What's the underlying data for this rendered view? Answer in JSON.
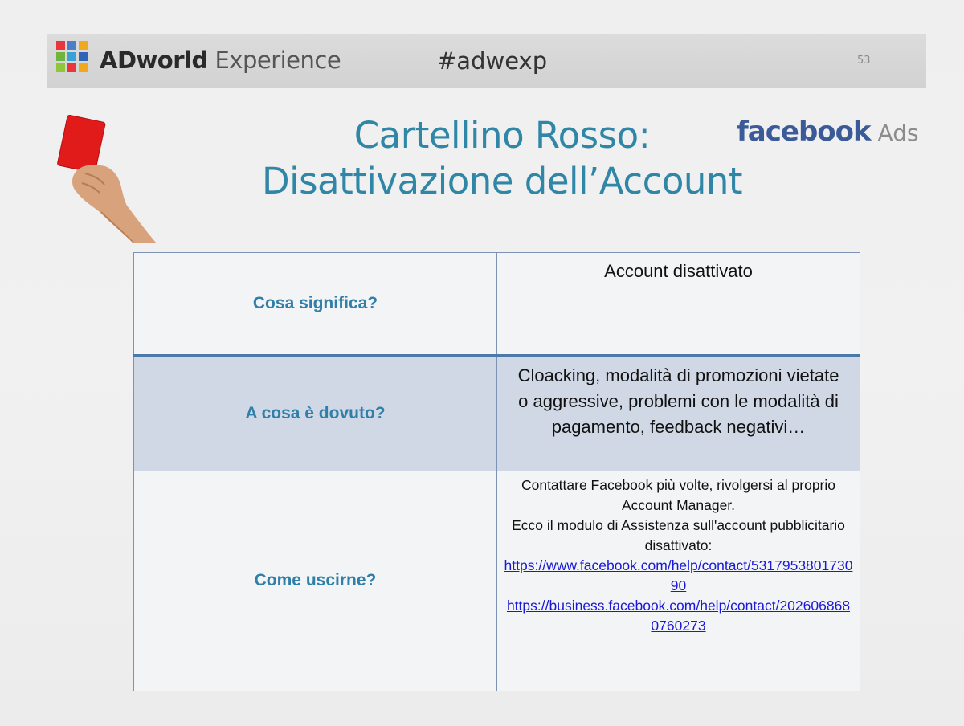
{
  "header": {
    "brand_bold": "ADworld",
    "brand_light": " Experience",
    "hashtag": "#adwexp",
    "slide_number": "53",
    "logo_colors": [
      "#e8363c",
      "#4a7fc7",
      "#f2a81d",
      "#6fb43f",
      "#3aa0d8",
      "#2f64b7",
      "#8fc63c",
      "#e8363c",
      "#f2a81d"
    ]
  },
  "title": {
    "line1": "Cartellino Rosso:",
    "line2": "Disattivazione dell’Account"
  },
  "brand_logo": {
    "name": "facebook",
    "suffix": " Ads"
  },
  "table": {
    "rows": [
      {
        "question": "Cosa significa?",
        "answer": "Account disattivato"
      },
      {
        "question": "A cosa è dovuto?",
        "answer": "Cloacking, modalità di promozioni vietate o aggressive, problemi con le modalità di pagamento, feedback negativi…"
      },
      {
        "question": "Come uscirne?",
        "answer_lines": [
          "Contattare Facebook più volte, rivolgersi al proprio",
          "Account Manager.",
          "Ecco il modulo di Assistenza sull'account pubblicitario disattivato:"
        ],
        "links": [
          "https://www.facebook.com/help/contact/531795380173090",
          "https://business.facebook.com/help/contact/2026068680760273"
        ]
      }
    ]
  },
  "colors": {
    "title": "#2f86a6",
    "question": "#2f7fa8",
    "facebook": "#3b5a98",
    "link": "#1a1ad6",
    "card": "#e11a1a"
  }
}
